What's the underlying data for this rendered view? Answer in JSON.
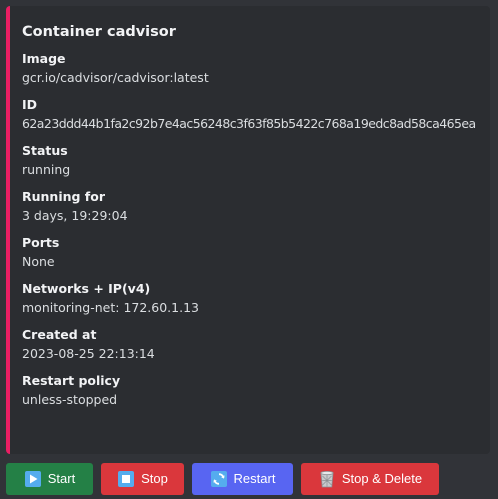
{
  "embed": {
    "accent_color": "#e91e63",
    "title": "Container cadvisor",
    "fields": [
      {
        "name": "Image",
        "value": "gcr.io/cadvisor/cadvisor:latest"
      },
      {
        "name": "ID",
        "value": "62a23ddd44b1fa2c92b7e4ac56248c3f63f85b5422c768a19edc8ad58ca465ea"
      },
      {
        "name": "Status",
        "value": "running"
      },
      {
        "name": "Running for",
        "value": "3 days, 19:29:04"
      },
      {
        "name": "Ports",
        "value": "None"
      },
      {
        "name": "Networks + IP(v4)",
        "value": "monitoring-net: 172.60.1.13"
      },
      {
        "name": "Created at",
        "value": "2023-08-25 22:13:14"
      },
      {
        "name": "Restart policy",
        "value": "unless-stopped"
      }
    ]
  },
  "buttons": {
    "start": {
      "label": "Start",
      "icon": "play-icon",
      "color": "#248046"
    },
    "stop": {
      "label": "Stop",
      "icon": "stop-icon",
      "color": "#da373c"
    },
    "restart": {
      "label": "Restart",
      "icon": "restart-icon",
      "color": "#5865f2"
    },
    "stop_delete": {
      "label": "Stop & Delete",
      "icon": "wastebasket-icon",
      "color": "#da373c"
    }
  }
}
